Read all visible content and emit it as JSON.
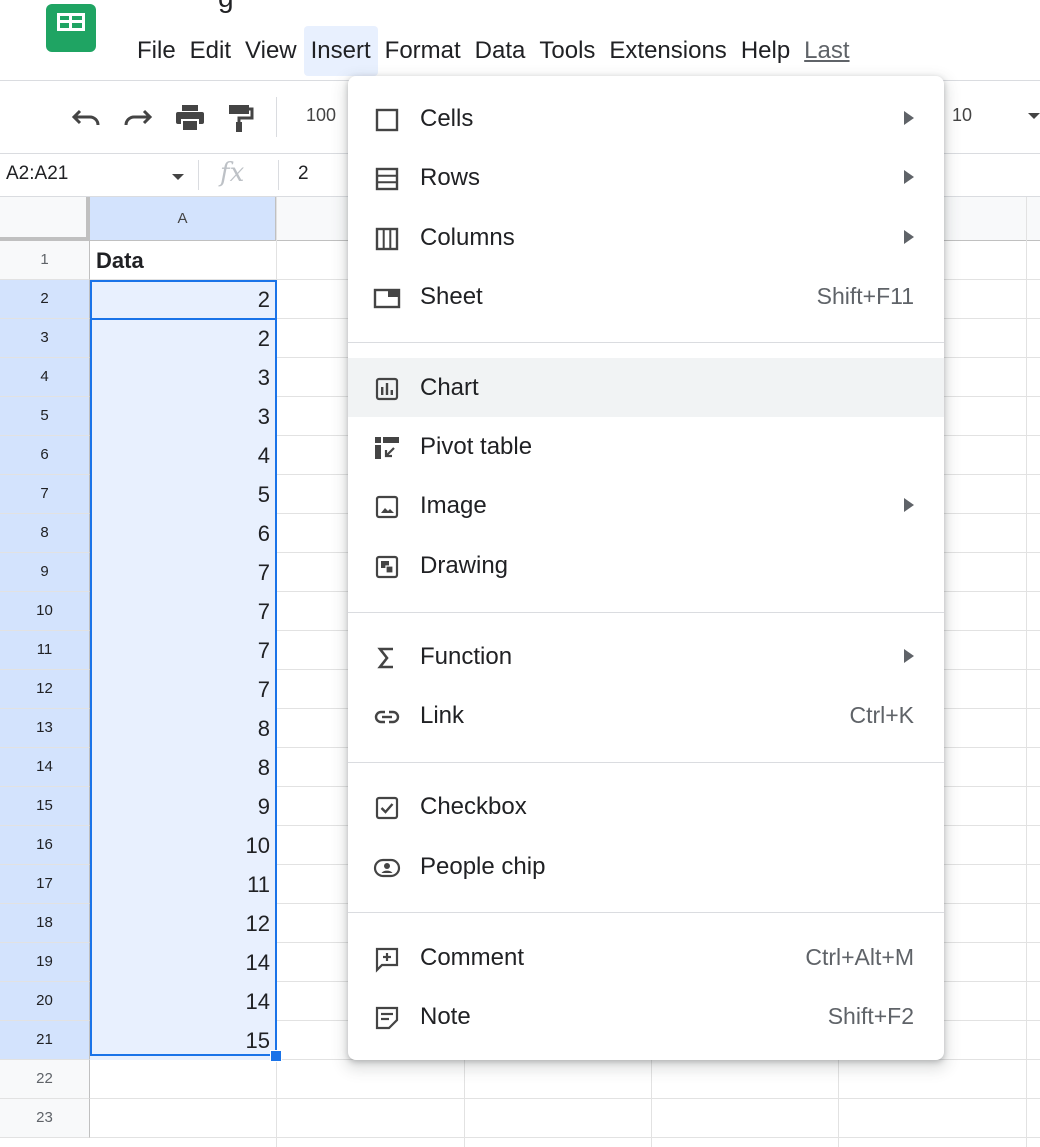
{
  "app": {
    "title_fragment": "g"
  },
  "menubar": {
    "items": [
      {
        "label": "File",
        "name": "menu-file"
      },
      {
        "label": "Edit",
        "name": "menu-edit"
      },
      {
        "label": "View",
        "name": "menu-view"
      },
      {
        "label": "Insert",
        "name": "menu-insert",
        "active": true
      },
      {
        "label": "Format",
        "name": "menu-format"
      },
      {
        "label": "Data",
        "name": "menu-data"
      },
      {
        "label": "Tools",
        "name": "menu-tools"
      },
      {
        "label": "Extensions",
        "name": "menu-extensions"
      },
      {
        "label": "Help",
        "name": "menu-help"
      },
      {
        "label": "Last",
        "name": "menu-last-edit"
      }
    ]
  },
  "toolbar": {
    "icons": [
      "undo-icon",
      "redo-icon",
      "print-icon",
      "paint-format-icon"
    ],
    "zoom": "100",
    "font_size": "10"
  },
  "formula_bar": {
    "name_box": "A2:A21",
    "fx": "fx",
    "value": "2"
  },
  "grid": {
    "column_a": "A",
    "row_numbers": [
      "1",
      "2",
      "3",
      "4",
      "5",
      "6",
      "7",
      "8",
      "9",
      "10",
      "11",
      "12",
      "13",
      "14",
      "15",
      "16",
      "17",
      "18",
      "19",
      "20",
      "21",
      "22",
      "23"
    ],
    "header_cell": "Data",
    "values": [
      "2",
      "2",
      "3",
      "3",
      "4",
      "5",
      "6",
      "7",
      "7",
      "7",
      "7",
      "8",
      "8",
      "9",
      "10",
      "11",
      "12",
      "14",
      "14",
      "15"
    ]
  },
  "insert_menu": {
    "items": [
      {
        "label": "Cells",
        "icon": "cells-icon",
        "submenu": true,
        "shortcut": ""
      },
      {
        "label": "Rows",
        "icon": "rows-icon",
        "submenu": true,
        "shortcut": ""
      },
      {
        "label": "Columns",
        "icon": "columns-icon",
        "submenu": true,
        "shortcut": ""
      },
      {
        "label": "Sheet",
        "icon": "sheet-icon",
        "submenu": false,
        "shortcut": "Shift+F11"
      },
      {
        "label": "Chart",
        "icon": "chart-icon",
        "submenu": false,
        "shortcut": "",
        "hover": true
      },
      {
        "label": "Pivot table",
        "icon": "pivot-table-icon",
        "submenu": false,
        "shortcut": ""
      },
      {
        "label": "Image",
        "icon": "image-icon",
        "submenu": true,
        "shortcut": ""
      },
      {
        "label": "Drawing",
        "icon": "drawing-icon",
        "submenu": false,
        "shortcut": ""
      },
      {
        "label": "Function",
        "icon": "function-icon",
        "submenu": true,
        "shortcut": ""
      },
      {
        "label": "Link",
        "icon": "link-icon",
        "submenu": false,
        "shortcut": "Ctrl+K"
      },
      {
        "label": "Checkbox",
        "icon": "checkbox-icon",
        "submenu": false,
        "shortcut": ""
      },
      {
        "label": "People chip",
        "icon": "people-chip-icon",
        "submenu": false,
        "shortcut": ""
      },
      {
        "label": "Comment",
        "icon": "comment-icon",
        "submenu": false,
        "shortcut": "Ctrl+Alt+M"
      },
      {
        "label": "Note",
        "icon": "note-icon",
        "submenu": false,
        "shortcut": "Shift+F2"
      }
    ]
  },
  "colors": {
    "accent": "#1a73e8",
    "selection_fill": "#e8f0fe",
    "logo_green": "#1fa463"
  }
}
